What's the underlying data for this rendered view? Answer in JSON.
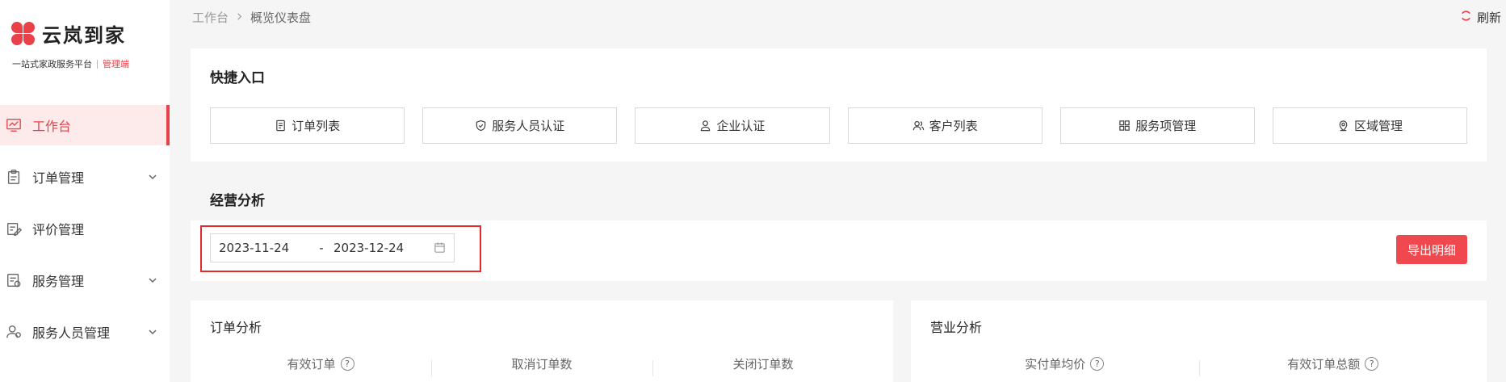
{
  "brand": {
    "name": "云岚到家",
    "subtitle": "一站式家政服务平台",
    "role": "管理端",
    "accent": "#e8414a"
  },
  "sidebar": {
    "items": [
      {
        "label": "工作台",
        "icon": "chart-monitor-icon",
        "active": true,
        "expandable": false
      },
      {
        "label": "订单管理",
        "icon": "clipboard-icon",
        "active": false,
        "expandable": true
      },
      {
        "label": "评价管理",
        "icon": "edit-note-icon",
        "active": false,
        "expandable": false
      },
      {
        "label": "服务管理",
        "icon": "service-list-icon",
        "active": false,
        "expandable": true
      },
      {
        "label": "服务人员管理",
        "icon": "users-icon",
        "active": false,
        "expandable": true
      }
    ]
  },
  "header": {
    "breadcrumb": [
      "工作台",
      "概览仪表盘"
    ],
    "refresh_label": "刷新"
  },
  "quick": {
    "title": "快捷入口",
    "buttons": [
      {
        "label": "订单列表",
        "icon": "document-icon"
      },
      {
        "label": "服务人员认证",
        "icon": "shield-check-icon"
      },
      {
        "label": "企业认证",
        "icon": "user-icon"
      },
      {
        "label": "客户列表",
        "icon": "users-icon"
      },
      {
        "label": "服务项管理",
        "icon": "grid-icon"
      },
      {
        "label": "区域管理",
        "icon": "location-icon"
      }
    ]
  },
  "business": {
    "title": "经营分析",
    "date_start": "2023-11-24",
    "date_separator": "-",
    "date_end": "2023-12-24",
    "export_label": "导出明细"
  },
  "orders_panel": {
    "title": "订单分析",
    "metrics": [
      {
        "label": "有效订单",
        "help": true
      },
      {
        "label": "取消订单数",
        "help": false
      },
      {
        "label": "关闭订单数",
        "help": false
      }
    ]
  },
  "revenue_panel": {
    "title": "营业分析",
    "metrics": [
      {
        "label": "实付单均价",
        "help": true
      },
      {
        "label": "有效订单总额",
        "help": true
      }
    ]
  },
  "help_glyph": "?"
}
